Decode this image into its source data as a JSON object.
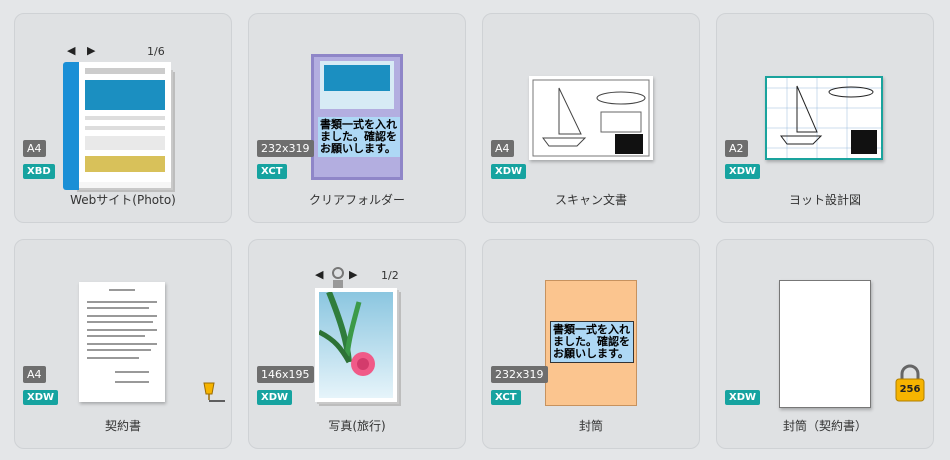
{
  "tiles": [
    {
      "caption": "Webサイト(Photo)",
      "size": "A4",
      "type": "XBD",
      "nav_prev": "◀",
      "nav_next": "▶",
      "page_count": "1/6"
    },
    {
      "caption": "クリアフォルダー",
      "size": "232x319",
      "type": "XCT",
      "thumb_text": "書類一式を入れました。確認をお願いします。"
    },
    {
      "caption": "スキャン文書",
      "size": "A4",
      "type": "XDW"
    },
    {
      "caption": "ヨット設計図",
      "size": "A2",
      "type": "XDW"
    },
    {
      "caption": "契約書",
      "size": "A4",
      "type": "XDW"
    },
    {
      "caption": "写真(旅行)",
      "size": "146x195",
      "type": "XDW",
      "nav_prev": "◀",
      "nav_next": "▶",
      "page_count": "1/2"
    },
    {
      "caption": "封筒",
      "size": "232x319",
      "type": "XCT",
      "thumb_text": "書類一式を入れました。確認をお願いします。"
    },
    {
      "caption": "封筒（契約書）",
      "type": "XDW",
      "lock_value": "256"
    }
  ],
  "colors": {
    "tile_bg": "#dfe1e3",
    "type_badge": "#16a3a0",
    "size_badge": "#6e6e6e",
    "binder_blue": "#1a8fd6",
    "folder_purple": "#8f86c8",
    "envelope_orange": "#fbc58f",
    "lock_gold": "#f6b400"
  },
  "icons": {
    "nav": "arrow-icons",
    "signature": "pen-icon",
    "lock": "lock-icon",
    "clip": "paper-clip-icon"
  }
}
